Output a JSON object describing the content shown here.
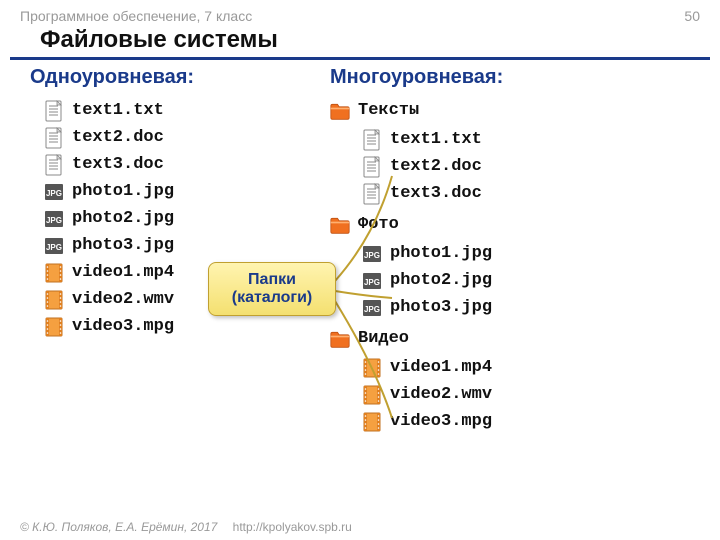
{
  "header": {
    "subject": "Программное обеспечение, 7 класс",
    "page": "50"
  },
  "title": "Файловые системы",
  "left": {
    "heading": "Одноуровневая:",
    "files": [
      {
        "type": "txt",
        "name": "text1.txt"
      },
      {
        "type": "txt",
        "name": "text2.doc"
      },
      {
        "type": "txt",
        "name": "text3.doc"
      },
      {
        "type": "jpg",
        "name": "photo1.jpg"
      },
      {
        "type": "jpg",
        "name": "photo2.jpg"
      },
      {
        "type": "jpg",
        "name": "photo3.jpg"
      },
      {
        "type": "vid",
        "name": "video1.mp4"
      },
      {
        "type": "vid",
        "name": "video2.wmv"
      },
      {
        "type": "vid",
        "name": "video3.mpg"
      }
    ]
  },
  "right": {
    "heading": "Многоуровневая:",
    "folders": [
      {
        "name": "Тексты",
        "files": [
          {
            "type": "txt",
            "name": "text1.txt"
          },
          {
            "type": "txt",
            "name": "text2.doc"
          },
          {
            "type": "txt",
            "name": "text3.doc"
          }
        ]
      },
      {
        "name": "Фото",
        "files": [
          {
            "type": "jpg",
            "name": "photo1.jpg"
          },
          {
            "type": "jpg",
            "name": "photo2.jpg"
          },
          {
            "type": "jpg",
            "name": "photo3.jpg"
          }
        ]
      },
      {
        "name": "Видео",
        "files": [
          {
            "type": "vid",
            "name": "video1.mp4"
          },
          {
            "type": "vid",
            "name": "video2.wmv"
          },
          {
            "type": "vid",
            "name": "video3.mpg"
          }
        ]
      }
    ]
  },
  "callout": {
    "line1": "Папки",
    "line2": "(каталоги)"
  },
  "footer": {
    "copyright": "© К.Ю. Поляков, Е.А. Ерёмин, 2017",
    "url": "http://kpolyakov.spb.ru"
  }
}
